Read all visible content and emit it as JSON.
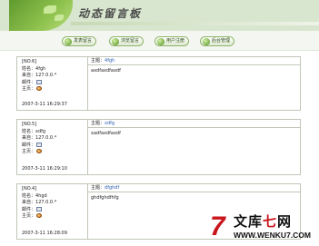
{
  "header": {
    "title": "动态留言板"
  },
  "nav": {
    "items": [
      {
        "label": "发表留言"
      },
      {
        "label": "浏览留言"
      },
      {
        "label": "用户注册"
      },
      {
        "label": "后台管理"
      }
    ]
  },
  "labels": {
    "name": "姓名：",
    "source": "来自：",
    "email": "邮件：",
    "homepage": "主页：",
    "subject": "主题："
  },
  "entries": [
    {
      "id": "[NO.6]",
      "name": "4fgh",
      "ip": "127.0.0.*",
      "subject": "4fgh",
      "content": "axdfaxdfaxdf",
      "time": "2007-3-11 16:29:37"
    },
    {
      "id": "[NO.5]",
      "name": "xdfg",
      "ip": "127.0.0.*",
      "subject": "xdfg",
      "content": "xadfaxdfaxdf",
      "time": "2007-3-11 16:29:10"
    },
    {
      "id": "[NO.4]",
      "name": "4hgd",
      "ip": "127.0.0.*",
      "subject": "dfghdf",
      "content": "ghdfghdfhfg",
      "time": "2007-3-11 16:28:09"
    }
  ],
  "watermark": {
    "logo": "7",
    "cn_a": "文库",
    "cn_b": "七",
    "cn_c": "网",
    "url": "WWW.WENKU7.COM"
  }
}
